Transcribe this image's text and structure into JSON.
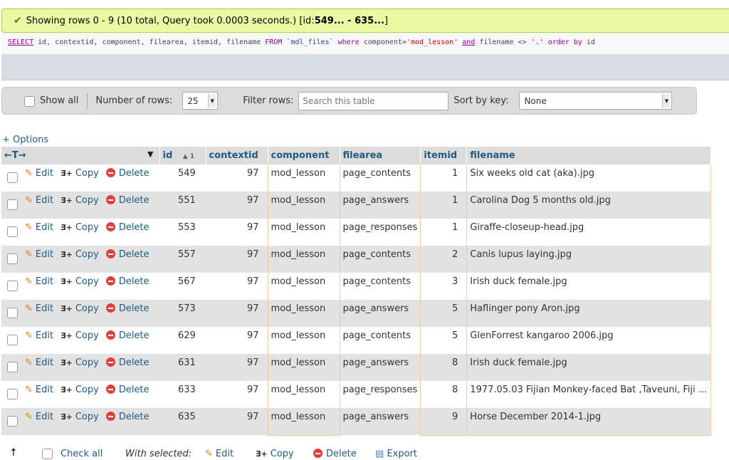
{
  "message": {
    "prefix": "Showing rows 0 - 9 (10 total, Query took 0.0003 seconds.) [id: ",
    "range": "549... - 635...",
    "suffix": "]"
  },
  "sql": {
    "select": "SELECT",
    "fields": " id, contextid, component, filearea, itemid, filename ",
    "from": "FROM",
    "table": "`mdl_files`",
    "where": "where",
    "cond1": " component=",
    "val1": "'mod_lesson'",
    "and": "and",
    "cond2": " filename <> ",
    "val2": "'.'",
    "order": "order by",
    "order_field": " id"
  },
  "nav": {
    "show_all": "Show all",
    "rows_label": "Number of rows:",
    "rows_value": "25",
    "filter_label": "Filter rows:",
    "filter_placeholder": "Search this table",
    "sort_label": "Sort by key:",
    "sort_value": "None"
  },
  "options_link": "+ Options",
  "table": {
    "resize_label": "←T→",
    "sort_indicator": "▲ 1",
    "headers": [
      "id",
      "contextid",
      "component",
      "filearea",
      "itemid",
      "filename"
    ],
    "actions": {
      "edit": "Edit",
      "copy": "Copy",
      "delete": "Delete"
    },
    "rows": [
      [
        "549",
        "97",
        "mod_lesson",
        "page_contents",
        "1",
        "Six weeks old cat (aka).jpg"
      ],
      [
        "551",
        "97",
        "mod_lesson",
        "page_answers",
        "1",
        "Carolina Dog 5 months old.jpg"
      ],
      [
        "553",
        "97",
        "mod_lesson",
        "page_responses",
        "1",
        "Giraffe-closeup-head.jpg"
      ],
      [
        "557",
        "97",
        "mod_lesson",
        "page_contents",
        "2",
        "Canis lupus laying.jpg"
      ],
      [
        "567",
        "97",
        "mod_lesson",
        "page_contents",
        "3",
        "Irish duck female.jpg"
      ],
      [
        "573",
        "97",
        "mod_lesson",
        "page_answers",
        "5",
        "Haflinger pony Aron.jpg"
      ],
      [
        "629",
        "97",
        "mod_lesson",
        "page_contents",
        "5",
        "GlenForrest kangaroo 2006.jpg"
      ],
      [
        "631",
        "97",
        "mod_lesson",
        "page_answers",
        "8",
        "Irish duck female.jpg"
      ],
      [
        "633",
        "97",
        "mod_lesson",
        "page_responses",
        "8",
        "1977.05.03 Fijian Monkey-faced Bat ,Taveuni, Fiji ..."
      ],
      [
        "635",
        "97",
        "mod_lesson",
        "page_answers",
        "9",
        "Horse December 2014-1.jpg"
      ]
    ]
  },
  "bottom": {
    "check_all": "Check all",
    "with_selected": "With selected:",
    "edit": "Edit",
    "copy": "Copy",
    "delete": "Delete",
    "export": "Export"
  }
}
